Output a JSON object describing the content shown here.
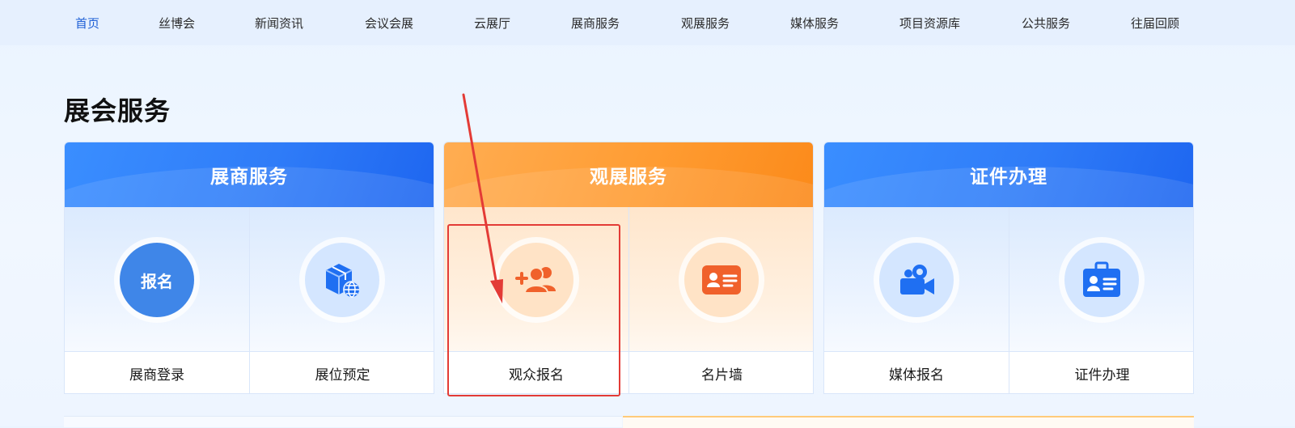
{
  "nav": {
    "items": [
      "首页",
      "丝博会",
      "新闻资讯",
      "会议会展",
      "云展厅",
      "展商服务",
      "观展服务",
      "媒体服务",
      "项目资源库",
      "公共服务",
      "往届回顾"
    ],
    "active_index": 0
  },
  "section": {
    "title": "展会服务"
  },
  "cards": [
    {
      "title": "展商服务",
      "theme": "blue",
      "items": [
        {
          "label": "展商登录",
          "icon": "register-badge-icon",
          "icon_text": "报名"
        },
        {
          "label": "展位预定",
          "icon": "booth-globe-icon"
        }
      ]
    },
    {
      "title": "观展服务",
      "theme": "orange",
      "items": [
        {
          "label": "观众报名",
          "icon": "add-people-icon"
        },
        {
          "label": "名片墙",
          "icon": "business-card-icon"
        }
      ]
    },
    {
      "title": "证件办理",
      "theme": "blue",
      "items": [
        {
          "label": "媒体报名",
          "icon": "video-camera-icon"
        },
        {
          "label": "证件办理",
          "icon": "id-badge-icon"
        }
      ]
    }
  ],
  "colors": {
    "primary_blue": "#2f7cf8",
    "primary_orange": "#ff9c32",
    "nav_active": "#1e5fd6",
    "annotation_red": "#e33b36",
    "icon_blue": "#1f6ff2",
    "icon_orange": "#f0612b"
  },
  "annotation": {
    "highlighted_item": "观众报名"
  }
}
